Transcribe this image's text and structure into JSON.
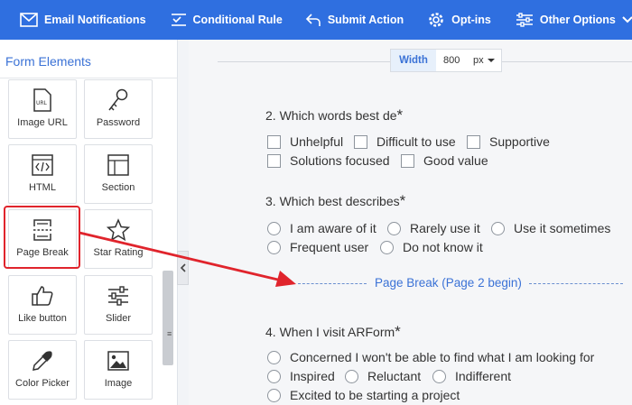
{
  "toolbar": {
    "items": [
      {
        "label": "Email Notifications",
        "icon": "envelope-icon"
      },
      {
        "label": "Conditional Rule",
        "icon": "checklist-icon"
      },
      {
        "label": "Submit Action",
        "icon": "reply-arrow-icon"
      },
      {
        "label": "Opt-ins",
        "icon": "cog-icon"
      },
      {
        "label": "Other Options",
        "icon": "sliders-icon"
      }
    ]
  },
  "sidebar": {
    "title": "Form Elements",
    "tiles": [
      {
        "label": "Image URL",
        "icon": "image-url-icon"
      },
      {
        "label": "Password",
        "icon": "key-icon"
      },
      {
        "label": "HTML",
        "icon": "code-icon"
      },
      {
        "label": "Section",
        "icon": "section-icon"
      },
      {
        "label": "Page Break",
        "icon": "page-break-icon"
      },
      {
        "label": "Star Rating",
        "icon": "star-icon"
      },
      {
        "label": "Like button",
        "icon": "thumbs-up-icon"
      },
      {
        "label": "Slider",
        "icon": "slider-icon"
      },
      {
        "label": "Color Picker",
        "icon": "eyedropper-icon"
      },
      {
        "label": "Image",
        "icon": "image-icon"
      }
    ]
  },
  "canvas": {
    "width_label": "Width",
    "width_value": "800",
    "width_unit": "px",
    "q2": {
      "title": "2. Which words best de",
      "options": [
        "Unhelpful",
        "Difficult to use",
        "Supportive",
        "Solutions focused",
        "Good value"
      ]
    },
    "q3": {
      "title": "3. Which best describes",
      "options": [
        "I am aware of it",
        "Rarely use it",
        "Use it sometimes",
        "Frequent user",
        "Do not know it"
      ]
    },
    "page_break": "Page Break (Page 2 begin)",
    "q4": {
      "title": "4. When I visit ARForm",
      "options": [
        "Concerned I won't be able to find what I am looking for",
        "Inspired",
        "Reluctant",
        "Indifferent",
        "Excited to be starting a project"
      ]
    },
    "required_mark": "*"
  },
  "colors": {
    "toolbar": "#2f6fe0",
    "accent": "#3b72d6",
    "highlight": "#e0242c"
  }
}
